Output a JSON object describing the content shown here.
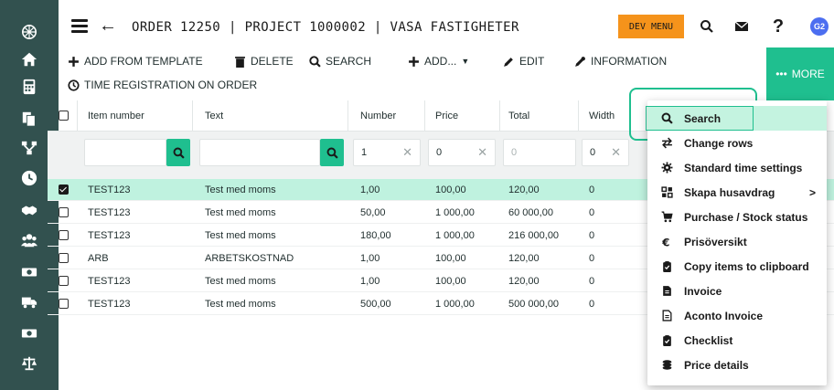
{
  "sidebar": {
    "icons": [
      "logo-icon",
      "home-icon",
      "calculator-icon",
      "documents-icon",
      "hierarchy-icon",
      "clock-icon",
      "handshake-icon",
      "users-icon",
      "money-icon",
      "truck-icon",
      "cash-icon",
      "scale-icon"
    ]
  },
  "header": {
    "title": "ORDER 12250 | PROJECT 1000002 | VASA FASTIGHETER",
    "dev_menu_label": "DEV MENU",
    "avatar_initials": "G2"
  },
  "toolbar": {
    "add_from_template": "ADD FROM TEMPLATE",
    "delete": "DELETE",
    "search": "SEARCH",
    "add": "ADD...",
    "edit": "EDIT",
    "information": "INFORMATION",
    "time_registration": "TIME REGISTRATION ON ORDER",
    "more": "MORE"
  },
  "table": {
    "columns": [
      "Item number",
      "Text",
      "Number",
      "Price",
      "Total",
      "Width"
    ],
    "filters": {
      "number": "1",
      "price": "0",
      "total_placeholder": "0",
      "width": "0"
    },
    "rows": [
      {
        "checked": true,
        "item": "TEST123",
        "text": "Test med moms",
        "number": "1,00",
        "price": "100,00",
        "total": "120,00",
        "width": "0"
      },
      {
        "checked": false,
        "item": "TEST123",
        "text": "Test med moms",
        "number": "50,00",
        "price": "1 000,00",
        "total": "60 000,00",
        "width": "0"
      },
      {
        "checked": false,
        "item": "TEST123",
        "text": "Test med moms",
        "number": "180,00",
        "price": "1 000,00",
        "total": "216 000,00",
        "width": "0"
      },
      {
        "checked": false,
        "item": "ARB",
        "text": "ARBETSKOSTNAD",
        "number": "1,00",
        "price": "100,00",
        "total": "120,00",
        "width": "0"
      },
      {
        "checked": false,
        "item": "TEST123",
        "text": "Test med moms",
        "number": "1,00",
        "price": "100,00",
        "total": "120,00",
        "width": "0"
      },
      {
        "checked": false,
        "item": "TEST123",
        "text": "Test med moms",
        "number": "500,00",
        "price": "1 000,00",
        "total": "500 000,00",
        "width": "0"
      }
    ]
  },
  "dropdown": {
    "items": [
      {
        "label": "Search",
        "icon": "search-icon"
      },
      {
        "label": "Change rows",
        "icon": "swap-icon"
      },
      {
        "label": "Standard time settings",
        "icon": "gear-icon"
      },
      {
        "label": "Skapa husavdrag",
        "icon": "grid-icon",
        "submenu_arrow": ">"
      },
      {
        "label": "Purchase / Stock status",
        "icon": "cart-icon"
      },
      {
        "label": "Prisöversikt",
        "icon": "euro-icon"
      },
      {
        "label": "Copy items to clipboard",
        "icon": "clipboard-icon"
      },
      {
        "label": "Invoice",
        "icon": "document-icon"
      },
      {
        "label": "Aconto Invoice",
        "icon": "document-outline-icon"
      },
      {
        "label": "Checklist",
        "icon": "checklist-icon"
      },
      {
        "label": "Price details",
        "icon": "coins-icon"
      }
    ]
  },
  "colors": {
    "sidebar": "#32514f",
    "accent": "#1fbf8f",
    "dev_menu": "#f5931b",
    "selected_row": "#bff2df",
    "avatar": "#4c6ef0"
  }
}
